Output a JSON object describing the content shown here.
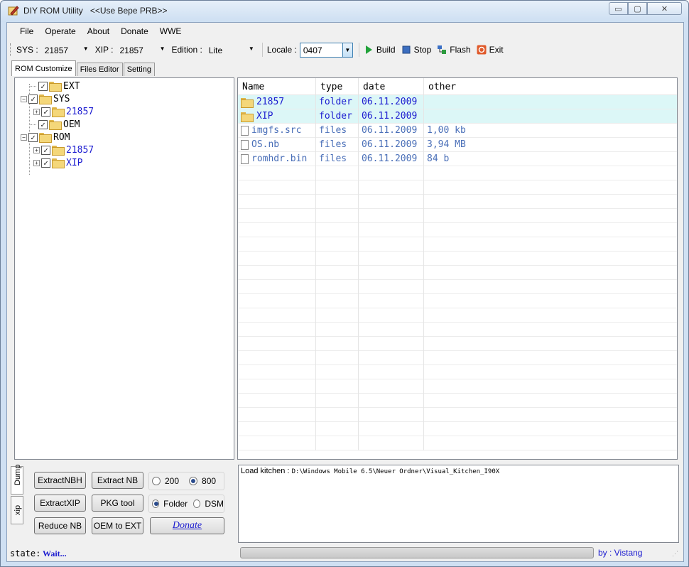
{
  "window": {
    "title": "DIY ROM Utility",
    "subtitle": "<<Use Bepe PRB>>",
    "min_glyph": "▭",
    "max_glyph": "▢",
    "close_glyph": "✕"
  },
  "menu": [
    "File",
    "Operate",
    "About",
    "Donate",
    "WWE"
  ],
  "toolbar": {
    "sys_label": "SYS :",
    "sys_value": "21857",
    "xip_label": "XIP :",
    "xip_value": "21857",
    "edition_label": "Edition :",
    "edition_value": "Lite",
    "locale_label": "Locale :",
    "locale_value": "0407",
    "build_label": "Build",
    "stop_label": "Stop",
    "flash_label": "Flash",
    "exit_label": "Exit",
    "icons": {
      "build": "play-icon",
      "stop": "stop-icon",
      "flash": "flash-icon",
      "exit": "exit-icon"
    }
  },
  "tabs": [
    "ROM Customize",
    "Files Editor",
    "Setting"
  ],
  "tree": [
    {
      "label": "EXT",
      "checked": true,
      "level": 0,
      "expandable": false
    },
    {
      "label": "SYS",
      "checked": true,
      "level": 0,
      "expandable": true,
      "expanded": true
    },
    {
      "label": "21857",
      "checked": true,
      "level": 1,
      "expandable": true,
      "expanded": false
    },
    {
      "label": "OEM",
      "checked": true,
      "level": 0,
      "expandable": false
    },
    {
      "label": "ROM",
      "checked": true,
      "level": 0,
      "expandable": true,
      "expanded": true
    },
    {
      "label": "21857",
      "checked": true,
      "level": 1,
      "expandable": true,
      "expanded": false
    },
    {
      "label": "XIP",
      "checked": true,
      "level": 1,
      "expandable": true,
      "expanded": false
    }
  ],
  "file_list": {
    "columns": [
      "Name",
      "type",
      "date",
      "other"
    ],
    "rows": [
      {
        "name": "21857",
        "type": "folder",
        "date": "06.11.2009",
        "other": "",
        "kind": "folder"
      },
      {
        "name": "XIP",
        "type": "folder",
        "date": "06.11.2009",
        "other": "",
        "kind": "folder"
      },
      {
        "name": "imgfs.src",
        "type": "files",
        "date": "06.11.2009",
        "other": "1,00 kb",
        "kind": "file"
      },
      {
        "name": "OS.nb",
        "type": "files",
        "date": "06.11.2009",
        "other": "3,94 MB",
        "kind": "file"
      },
      {
        "name": "romhdr.bin",
        "type": "files",
        "date": "06.11.2009",
        "other": "84 b",
        "kind": "file"
      }
    ]
  },
  "side_tabs": [
    "Dump",
    "xip"
  ],
  "ops": {
    "extract_nbh": "ExtractNBH",
    "extract_nb": "Extract NB",
    "extract_xip": "ExtractXIP",
    "pkg_tool": "PKG tool",
    "reduce_nb": "Reduce NB",
    "oem_to_ext": "OEM to EXT",
    "donate": "Donate",
    "res_200": "200",
    "res_800": "800",
    "res_selected": "800",
    "mode_folder": "Folder",
    "mode_dsm": "DSM",
    "mode_selected": "Folder"
  },
  "log": {
    "label": "Load kitchen :",
    "path": "D:\\Windows Mobile 6.5\\Neuer Ordner\\Visual_Kitchen_I90X"
  },
  "status": {
    "state_label": "state:",
    "state_value": "Wait...",
    "author": "by : Vistang",
    "progress": 0
  }
}
